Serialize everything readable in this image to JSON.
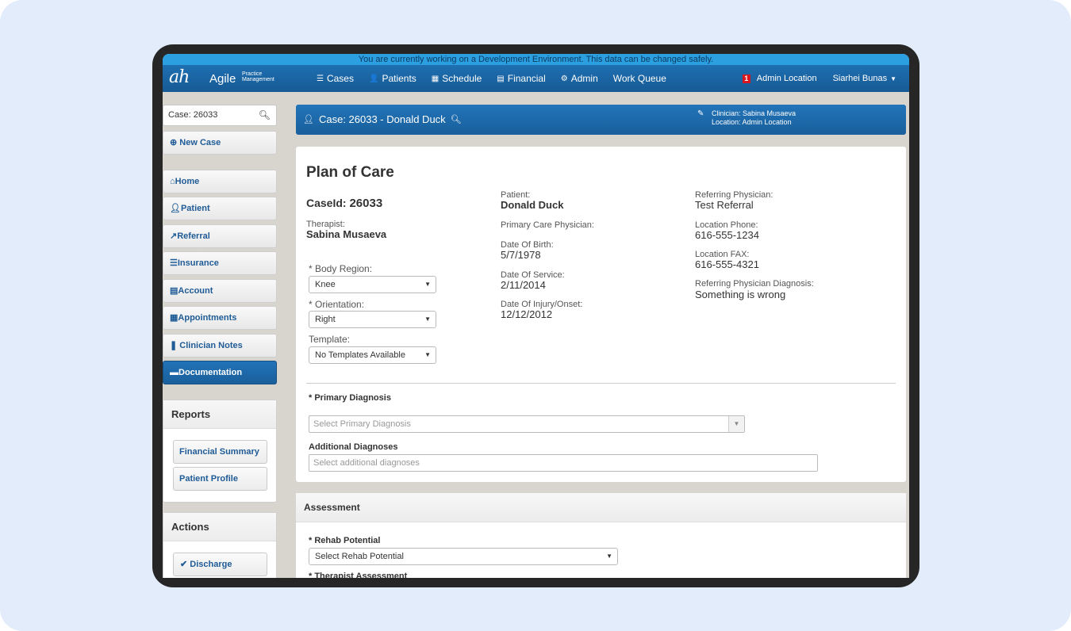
{
  "dev_banner": "You are currently working on a Development Environment. This data can be changed safely.",
  "navbar": {
    "logo": "ah",
    "brand": "Agile",
    "brand_sub_1": "Practice",
    "brand_sub_2": "Management",
    "items": [
      {
        "icon": "cases-icon",
        "label": "Cases"
      },
      {
        "icon": "patients-icon",
        "label": "Patients"
      },
      {
        "icon": "schedule-icon",
        "label": "Schedule"
      },
      {
        "icon": "financial-icon",
        "label": "Financial"
      },
      {
        "icon": "admin-icon",
        "label": "Admin"
      },
      {
        "icon": "",
        "label": "Work Queue"
      }
    ],
    "notification_count": "1",
    "location": "Admin Location",
    "user": "Siarhei Bunas"
  },
  "sidebar": {
    "search_value": "Case: 26033",
    "new_case": "New Case",
    "items": [
      {
        "label": "Home"
      },
      {
        "label": "Patient"
      },
      {
        "label": "Referral"
      },
      {
        "label": "Insurance"
      },
      {
        "label": "Account"
      },
      {
        "label": "Appointments"
      },
      {
        "label": "Clinician Notes"
      },
      {
        "label": "Documentation"
      }
    ],
    "reports": {
      "title": "Reports",
      "items": [
        "Financial Summary",
        "Patient Profile"
      ]
    },
    "actions": {
      "title": "Actions",
      "items": [
        "Discharge"
      ]
    }
  },
  "case_header": {
    "title": "Case: 26033 - Donald Duck",
    "clinician": "Clinician: Sabina Musaeva",
    "location": "Location: Admin Location"
  },
  "plan_of_care": {
    "title": "Plan of Care",
    "case_id_label": "CaseId:",
    "case_id": "26033",
    "therapist_label": "Therapist:",
    "therapist": "Sabina Musaeva",
    "body_region_label": "* Body Region:",
    "body_region": "Knee",
    "orientation_label": "* Orientation:",
    "orientation": "Right",
    "template_label": "Template:",
    "template": "No Templates Available",
    "patient_label": "Patient:",
    "patient": "Donald Duck",
    "pcp_label": "Primary Care Physician:",
    "dob_label": "Date Of Birth:",
    "dob": "5/7/1978",
    "dos_label": "Date Of Service:",
    "dos": "2/11/2014",
    "doi_label": "Date Of Injury/Onset:",
    "doi": "12/12/2012",
    "ref_phys_label": "Referring Physician:",
    "ref_phys": "Test Referral",
    "loc_phone_label": "Location Phone:",
    "loc_phone": "616-555-1234",
    "loc_fax_label": "Location FAX:",
    "loc_fax": "616-555-4321",
    "ref_diag_label": "Referring Physician Diagnosis:",
    "ref_diag": "Something is wrong",
    "primary_diag_label": "* Primary Diagnosis",
    "primary_diag_placeholder": "Select Primary Diagnosis",
    "additional_diag_label": "Additional Diagnoses",
    "additional_diag_placeholder": "Select additional diagnoses"
  },
  "assessment": {
    "title": "Assessment",
    "rehab_label": "* Rehab Potential",
    "rehab_value": "Select Rehab Potential",
    "therapist_assessment_label": "* Therapist Assessment"
  }
}
